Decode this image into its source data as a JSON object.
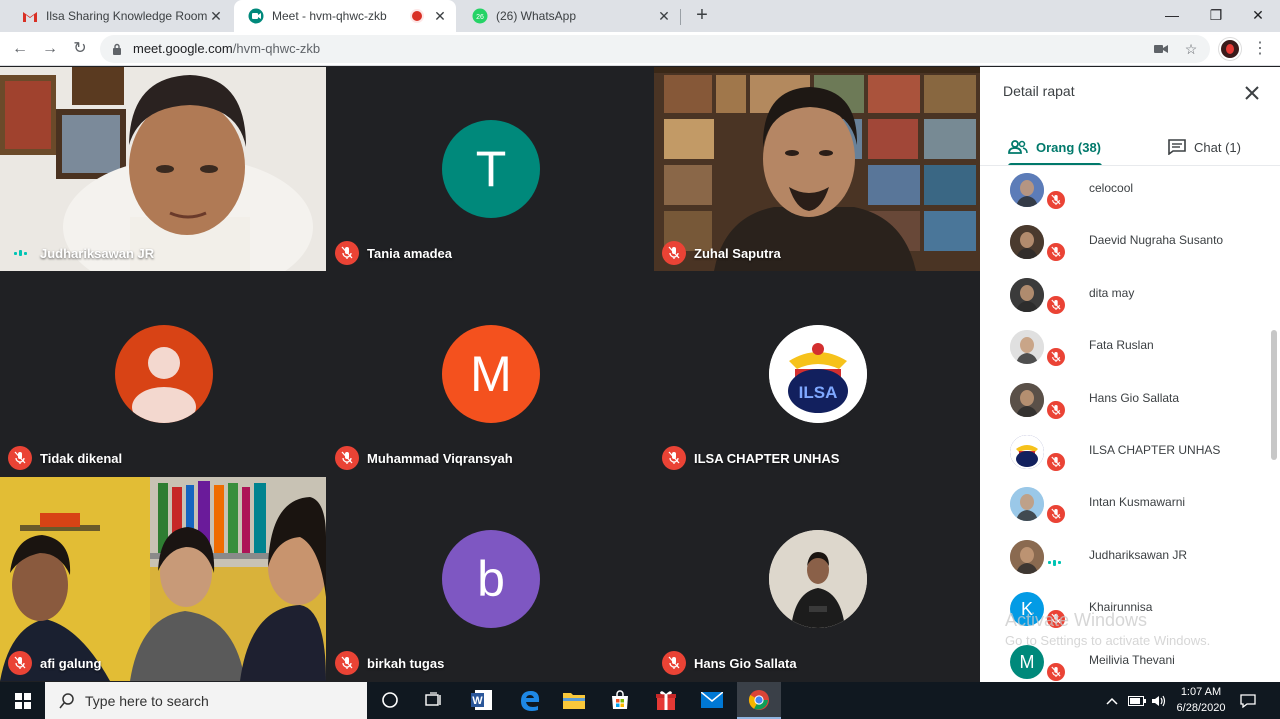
{
  "browser": {
    "tabs": [
      {
        "title": "Ilsa Sharing Knowledge Room Lin",
        "favicon": "gmail-icon"
      },
      {
        "title": "Meet - hvm-qhwc-zkb",
        "favicon": "meet-icon",
        "recording": true
      },
      {
        "title": "(26) WhatsApp",
        "favicon": "whatsapp-icon",
        "badge": "26"
      }
    ],
    "url_host": "meet.google.com",
    "url_path": "/hvm-qhwc-zkb"
  },
  "tiles": [
    {
      "name": "Judhariksawan JR",
      "type": "video",
      "status": "speaking"
    },
    {
      "name": "Tania amadea",
      "type": "avatar",
      "letter": "T",
      "color": "#00897b",
      "status": "muted"
    },
    {
      "name": "Zuhal Saputra",
      "type": "video",
      "status": "muted"
    },
    {
      "name": "Tidak dikenal",
      "type": "avatar",
      "letter": "",
      "color": "#d84315",
      "status": "muted"
    },
    {
      "name": "Muhammad Viqransyah",
      "type": "avatar",
      "letter": "M",
      "color": "#f4511e",
      "status": "muted"
    },
    {
      "name": "ILSA CHAPTER UNHAS",
      "type": "logo",
      "logo_text": "ILSA",
      "status": "muted"
    },
    {
      "name": "afi galung",
      "type": "video",
      "status": "muted"
    },
    {
      "name": "birkah tugas",
      "type": "avatar",
      "letter": "b",
      "color": "#7e57c2",
      "status": "muted"
    },
    {
      "name": "Hans Gio Sallata",
      "type": "photo",
      "status": "muted"
    }
  ],
  "panel": {
    "title": "Detail rapat",
    "tab_people": "Orang (38)",
    "tab_chat": "Chat (1)",
    "participants": [
      {
        "name": "celocool",
        "avatar": "photo",
        "color": "#5c7cb8",
        "status": "muted"
      },
      {
        "name": "Daevid Nugraha Susanto",
        "avatar": "photo",
        "color": "#4a3a2e",
        "status": "muted"
      },
      {
        "name": "dita may",
        "avatar": "photo",
        "color": "#3b3b3b",
        "status": "muted"
      },
      {
        "name": "Fata Ruslan",
        "avatar": "photo",
        "color": "#e0e0e0",
        "status": "muted"
      },
      {
        "name": "Hans Gio Sallata",
        "avatar": "photo",
        "color": "#5a5048",
        "status": "muted"
      },
      {
        "name": "ILSA CHAPTER UNHAS",
        "avatar": "logo",
        "color": "#1a237e",
        "status": "muted"
      },
      {
        "name": "Intan Kusmawarni",
        "avatar": "photo",
        "color": "#9ac8e8",
        "status": "muted"
      },
      {
        "name": "Judhariksawan JR",
        "avatar": "photo",
        "color": "#8a6a50",
        "status": "speaking"
      },
      {
        "name": "Khairunnisa",
        "avatar": "letter",
        "letter": "K",
        "color": "#039be5",
        "status": "muted"
      },
      {
        "name": "Meilivia Thevani",
        "avatar": "letter",
        "letter": "M",
        "color": "#00897b",
        "status": "muted"
      }
    ]
  },
  "watermark": {
    "line1": "Activate Windows",
    "line2": "Go to Settings to activate Windows."
  },
  "taskbar": {
    "search_placeholder": "Type here to search",
    "time": "1:07 AM",
    "date": "6/28/2020"
  },
  "colors": {
    "accent": "#00796b",
    "mic_off": "#ea4335",
    "speaking": "#00c4b4"
  }
}
